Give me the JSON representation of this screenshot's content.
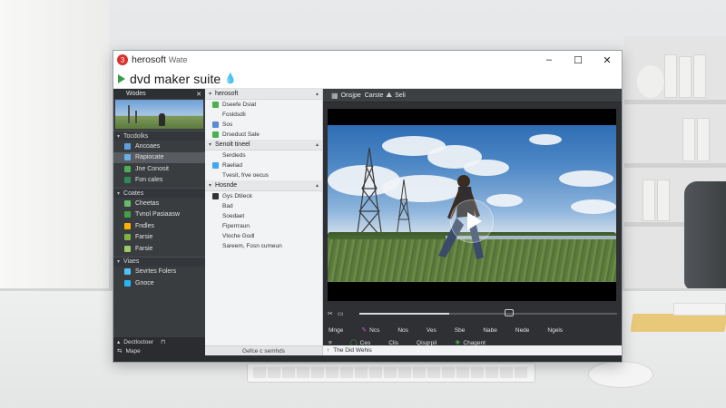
{
  "window": {
    "title": "herosoft",
    "title_sub": "Wate",
    "title_icon": "3",
    "controls": {
      "minimize": "–",
      "maximize": "☐",
      "close": "✕"
    }
  },
  "app": {
    "name": "dvd maker suite",
    "logo_color": "#3a9a4a",
    "brand_color": "#d9302c"
  },
  "left_panel": {
    "header": "Wodes",
    "sections": [
      {
        "label": "Tocdolks",
        "items": [
          {
            "label": "Ancoaes",
            "icon": "video-icon",
            "color": "#5aa0e0",
            "selected": false
          },
          {
            "label": "Rapiocate",
            "icon": "clip-icon",
            "color": "#6ab0e6",
            "selected": true
          },
          {
            "label": "Jne Conosit",
            "icon": "layers-icon",
            "color": "#4caf50",
            "selected": false
          },
          {
            "label": "Fon cales",
            "icon": "folder-icon",
            "color": "#2e8b57",
            "selected": false
          }
        ]
      },
      {
        "label": "Coates",
        "items": [
          {
            "label": "Cheetas",
            "icon": "doc-icon",
            "color": "#66bb6a",
            "selected": false
          },
          {
            "label": "Tvnol Pasiaasw",
            "icon": "chart-icon",
            "color": "#43a047",
            "selected": false
          },
          {
            "label": "Fndles",
            "icon": "star-icon",
            "color": "#ffb300",
            "selected": false
          },
          {
            "label": "Farsie",
            "icon": "tag-icon",
            "color": "#7cb342",
            "selected": false
          },
          {
            "label": "Farsie",
            "icon": "tag-icon",
            "color": "#9ccc65",
            "selected": false
          }
        ]
      },
      {
        "label": "Viaes",
        "items": [
          {
            "label": "Sevrtes Folers",
            "icon": "grid-icon",
            "color": "#4fc3f7",
            "selected": false
          },
          {
            "label": "Gnoce",
            "icon": "cog-icon",
            "color": "#29b6f6",
            "selected": false
          }
        ]
      }
    ],
    "footer": [
      {
        "label": "Dectloctoer",
        "suffix": "⊓"
      },
      {
        "label": "Mape"
      }
    ]
  },
  "mid_panel": {
    "groups": [
      {
        "label": "herosoft",
        "items": [
          {
            "label": "Dseefe Dsiat",
            "icon": "film-icon",
            "color": "#4caf50"
          },
          {
            "label": "Fosldsdli",
            "icon": "",
            "color": ""
          },
          {
            "label": "Sos",
            "icon": "box-icon",
            "color": "#5b8bd4"
          },
          {
            "label": "Drseduct Sale",
            "icon": "disc-icon",
            "color": "#4caf50"
          }
        ]
      },
      {
        "label": "Senolt tineel",
        "items": [
          {
            "label": "Serdieds",
            "icon": "",
            "color": ""
          },
          {
            "label": "Raeliad",
            "icon": "globe-icon",
            "color": "#42a5f5"
          },
          {
            "label": "Tvesit, frve oecus",
            "icon": "",
            "color": ""
          }
        ]
      },
      {
        "label": "Hosnde",
        "items": [
          {
            "label": "Gys Dtileck",
            "icon": "monitor-icon",
            "color": "#333333"
          },
          {
            "label": "Bad",
            "icon": "",
            "color": ""
          },
          {
            "label": "Soedaet",
            "icon": "",
            "color": ""
          },
          {
            "label": "Fiperrraun",
            "icon": "",
            "color": ""
          },
          {
            "label": "Vloche Godl",
            "icon": "",
            "color": ""
          },
          {
            "label": "Sareem, Fosn cumeun",
            "icon": "",
            "color": ""
          }
        ]
      }
    ],
    "footer": "Gefce c semhds"
  },
  "preview": {
    "toolbar": {
      "label1": "Onsjpe",
      "label2": "Carste",
      "label3": "Seli"
    },
    "progress": 0.35,
    "controls_row1": [
      {
        "label": "Mnge",
        "icon": "",
        "color": "#e2e2e2"
      },
      {
        "label": "Ncs",
        "icon": "✎",
        "color": "#c55ad1"
      },
      {
        "label": "Nos",
        "icon": "",
        "color": "#e2e2e2"
      },
      {
        "label": "Ves",
        "icon": "",
        "color": "#e2e2e2"
      },
      {
        "label": "Sbe",
        "icon": "",
        "color": "#e2e2e2"
      },
      {
        "label": "Nabe",
        "icon": "",
        "color": "#e2e2e2"
      },
      {
        "label": "Nede",
        "icon": "",
        "color": "#e2e2e2"
      },
      {
        "label": "Ngels",
        "icon": "",
        "color": "#e2e2e2"
      }
    ],
    "controls_row2": [
      {
        "label": "≡",
        "icon": "",
        "color": "#e2e2e2"
      },
      {
        "label": "Ces",
        "icon": "◯",
        "color": "#4caf50"
      },
      {
        "label": "Clis",
        "icon": "",
        "color": "#e2e2e2"
      },
      {
        "label": "Qisgrpil",
        "icon": "",
        "color": "#e2e2e2"
      },
      {
        "label": "Chagent",
        "icon": "❖",
        "color": "#4caf50"
      }
    ],
    "status": "The Did Wehis"
  }
}
